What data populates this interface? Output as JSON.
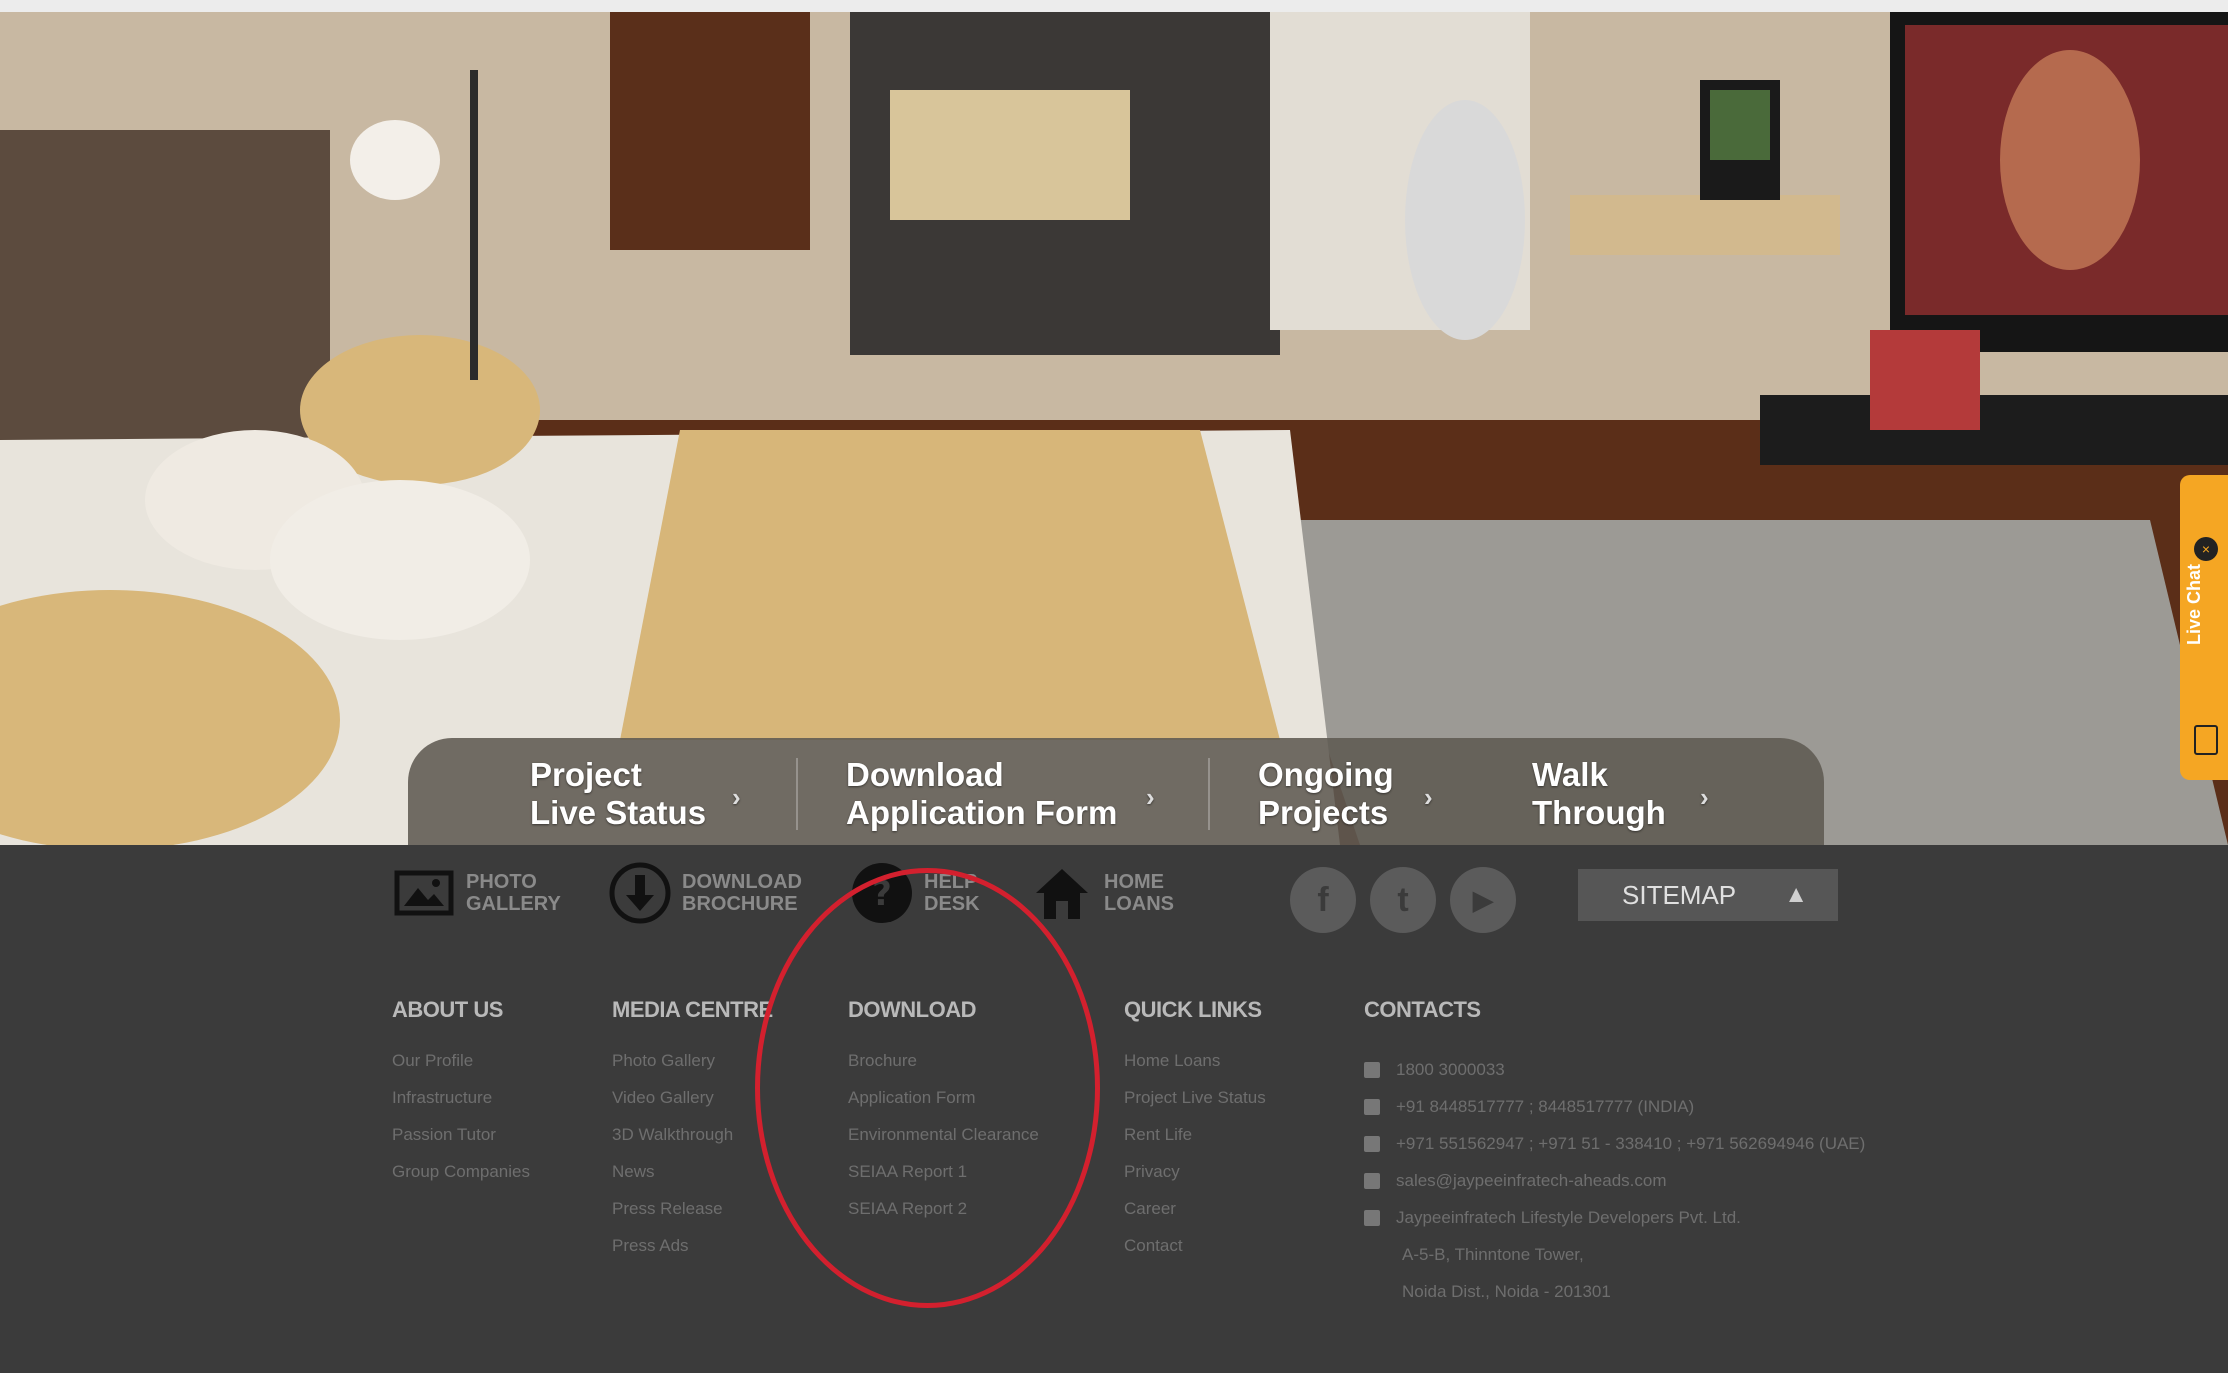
{
  "hero": {
    "alt": "bedroom interior render"
  },
  "cta_bar": {
    "items": [
      {
        "line1": "Project",
        "line2": "Live Status"
      },
      {
        "line1": "Download",
        "line2": "Application Form"
      },
      {
        "line1": "Ongoing",
        "line2": "Projects"
      },
      {
        "line1": "Walk",
        "line2": "Through"
      }
    ],
    "arrow": "›"
  },
  "live_chat": {
    "label": "Live Chat"
  },
  "quick_icons": [
    {
      "icon": "photo-gallery-icon",
      "line1": "PHOTO",
      "line2": "GALLERY"
    },
    {
      "icon": "download-icon",
      "line1": "DOWNLOAD",
      "line2": "BROCHURE"
    },
    {
      "icon": "help-icon",
      "line1": "HELP",
      "line2": "DESK"
    },
    {
      "icon": "home-icon",
      "line1": "HOME",
      "line2": "LOANS"
    }
  ],
  "social": [
    {
      "icon": "facebook-icon",
      "glyph": "f"
    },
    {
      "icon": "twitter-icon",
      "glyph": "t"
    },
    {
      "icon": "youtube-icon",
      "glyph": "▶"
    }
  ],
  "sitemap": {
    "label": "SITEMAP",
    "arrow": "▲"
  },
  "columns": {
    "about": {
      "heading": "ABOUT US",
      "links": [
        "Our Profile",
        "Infrastructure",
        "Passion Tutor",
        "Group Companies"
      ]
    },
    "media": {
      "heading": "MEDIA CENTRE",
      "links": [
        "Photo Gallery",
        "Video Gallery",
        "3D Walkthrough",
        "News",
        "Press Release",
        "Press Ads"
      ]
    },
    "download": {
      "heading": "DOWNLOAD",
      "links": [
        "Brochure",
        "Application Form",
        "Environmental Clearance",
        "SEIAA Report 1",
        "SEIAA Report 2"
      ]
    },
    "quick": {
      "heading": "QUICK LINKS",
      "links": [
        "Home Loans",
        "Project Live Status",
        "Rent Life",
        "Privacy",
        "Career",
        "Contact"
      ]
    },
    "contacts": {
      "heading": "CONTACTS",
      "rows": [
        "1800 3000033",
        "+91 8448517777 ; 8448517777 (INDIA)",
        "+971 551562947 ; +971 51 - 338410 ; +971 562694946 (UAE)",
        "sales@jaypeeinfratech-aheads.com",
        "Jaypeeinfratech Lifestyle Developers Pvt. Ltd.",
        "A-5-B, Thinntone Tower,",
        "Noida Dist., Noida - 201301"
      ]
    }
  },
  "colors": {
    "footer_bg": "#3b3b3b",
    "cta_bg": "#5f5a52",
    "accent": "#f5a623",
    "highlight_circle": "#d3202e"
  }
}
